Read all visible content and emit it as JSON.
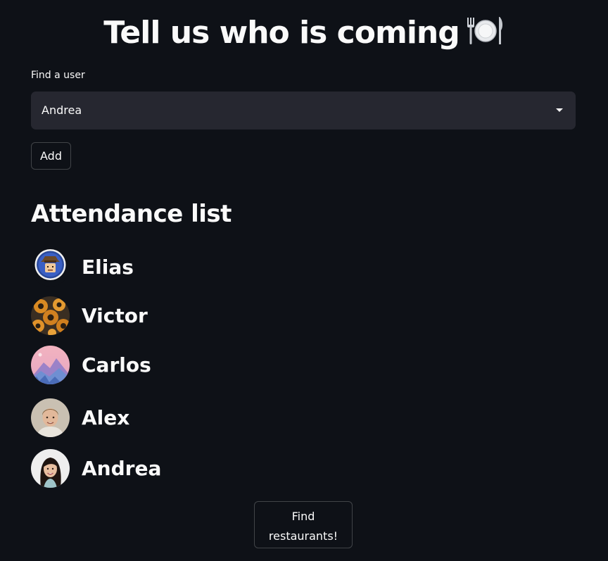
{
  "header": {
    "title": "Tell us who is coming",
    "title_emoji": "fork-knife-plate-icon"
  },
  "user_select": {
    "label": "Find a user",
    "value": "Andrea"
  },
  "add_button": {
    "label": "Add"
  },
  "attendance": {
    "title": "Attendance list",
    "people": [
      {
        "name": "Elias",
        "avatar": "cartoon-explorer-avatar"
      },
      {
        "name": "Victor",
        "avatar": "sunflower-pattern-avatar"
      },
      {
        "name": "Carlos",
        "avatar": "mountain-landscape-avatar"
      },
      {
        "name": "Alex",
        "avatar": "man-portrait-avatar"
      },
      {
        "name": "Andrea",
        "avatar": "woman-portrait-avatar"
      }
    ]
  },
  "find_button": {
    "line1": "Find",
    "line2": "restaurants!"
  },
  "colors": {
    "background": "#0e1117",
    "select_bg": "#262730",
    "text": "#fafafa"
  }
}
